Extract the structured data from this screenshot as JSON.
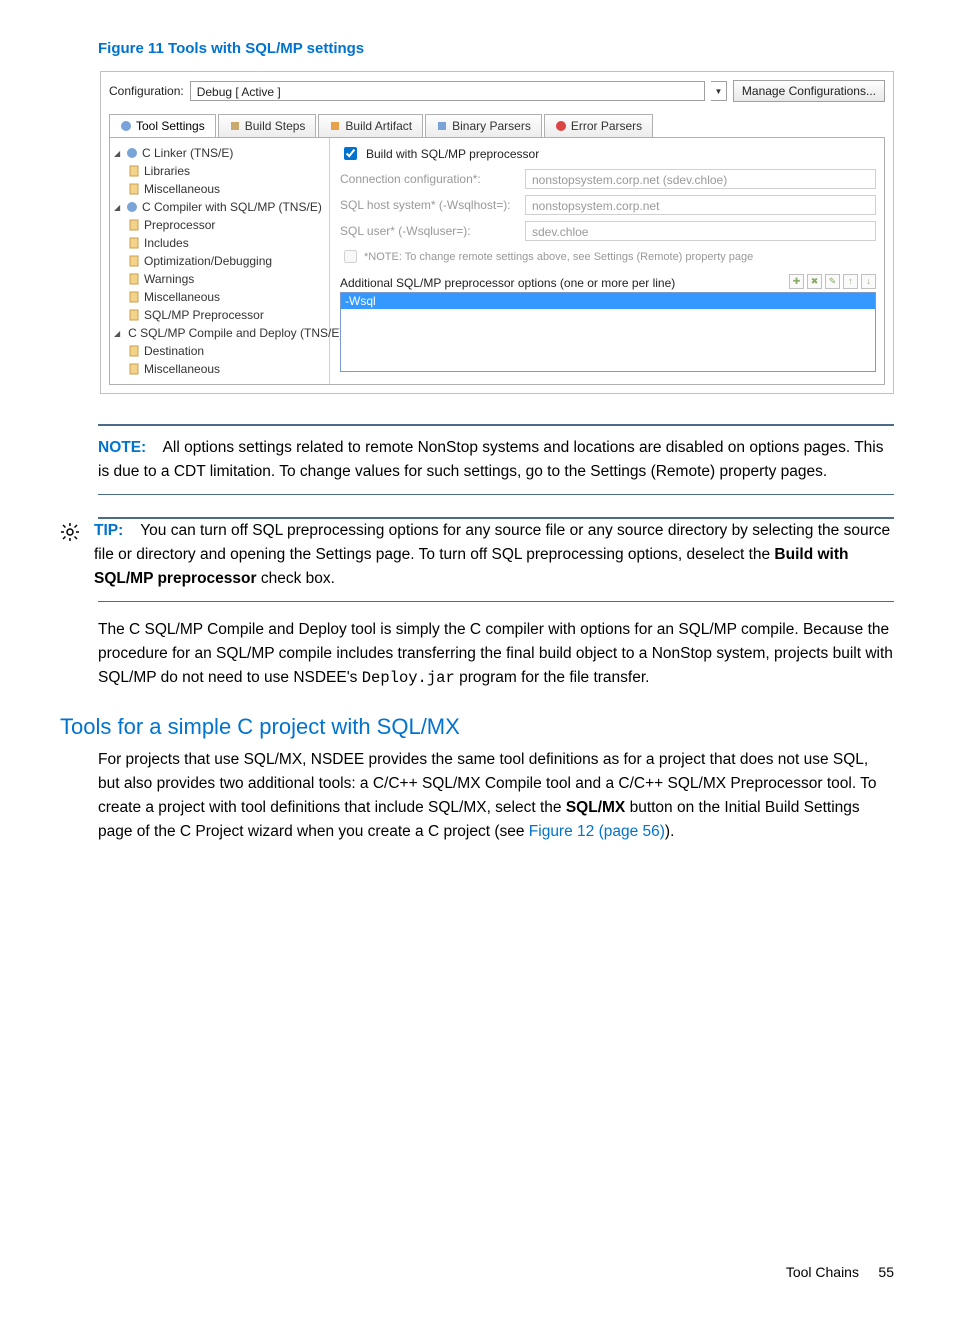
{
  "figure": {
    "title": "Figure 11 Tools with SQL/MP settings"
  },
  "dialog": {
    "config_label": "Configuration:",
    "config_value": "Debug [ Active ]",
    "manage_btn": "Manage Configurations...",
    "tabs": {
      "tool_settings": "Tool Settings",
      "build_steps": "Build Steps",
      "build_artifact": "Build Artifact",
      "binary_parsers": "Binary Parsers",
      "error_parsers": "Error Parsers"
    },
    "tree": {
      "linker": "C Linker (TNS/E)",
      "linker_children": {
        "libraries": "Libraries",
        "misc": "Miscellaneous"
      },
      "compiler": "C Compiler with SQL/MP (TNS/E)",
      "compiler_children": {
        "preproc": "Preprocessor",
        "includes": "Includes",
        "opt": "Optimization/Debugging",
        "warn": "Warnings",
        "misc": "Miscellaneous",
        "sqlmp": "SQL/MP Preprocessor"
      },
      "deploy": "C SQL/MP Compile and Deploy (TNS/E)",
      "deploy_children": {
        "dest": "Destination",
        "misc": "Miscellaneous"
      }
    },
    "form": {
      "build_with": "Build with SQL/MP preprocessor",
      "conn_label": "Connection configuration*:",
      "conn_value": "nonstopsystem.corp.net (sdev.chloe)",
      "host_label": "SQL host system* (-Wsqlhost=):",
      "host_value": "nonstopsystem.corp.net",
      "user_label": "SQL user* (-Wsqluser=):",
      "user_value": "sdev.chloe",
      "note": "*NOTE: To change remote settings above, see Settings (Remote) property page",
      "opts_label": "Additional SQL/MP preprocessor options (one or more per line)",
      "opts_value": "-Wsql"
    }
  },
  "note": {
    "lead": "NOTE:",
    "text": "All options settings related to remote NonStop systems and locations are disabled on options pages. This is due to a CDT limitation. To change values for such settings, go to the Settings (Remote) property pages."
  },
  "tip": {
    "lead": "TIP:",
    "text_a": "You can turn off SQL preprocessing options for any source file or any source directory by selecting the source file or directory and opening the Settings page. To turn off SQL preprocessing options, deselect the ",
    "bold": "Build with SQL/MP preprocessor",
    "text_b": " check box."
  },
  "para1": {
    "a": "The C SQL/MP Compile and Deploy tool is simply the C compiler with options for an SQL/MP compile. Because the procedure for an SQL/MP compile includes transferring the final build object to a NonStop system, projects built with SQL/MP do not need to use NSDEE's ",
    "code": "Deploy.jar",
    "b": " program for the file transfer."
  },
  "section": {
    "title": "Tools for a simple C project with SQL/MX"
  },
  "para2": {
    "a": "For projects that use SQL/MX, NSDEE provides the same tool definitions as for a project that does not use SQL, but also provides two additional tools: a C/C++ SQL/MX Compile tool and a C/C++ SQL/MX Preprocessor tool. To create a project with tool definitions that include SQL/MX, select the ",
    "bold": "SQL/MX",
    "b": " button on the Initial Build Settings page of the C Project wizard when you create a C project (see ",
    "link": "Figure 12 (page 56)",
    "c": ")."
  },
  "footer": {
    "text": "Tool Chains",
    "page": "55"
  }
}
